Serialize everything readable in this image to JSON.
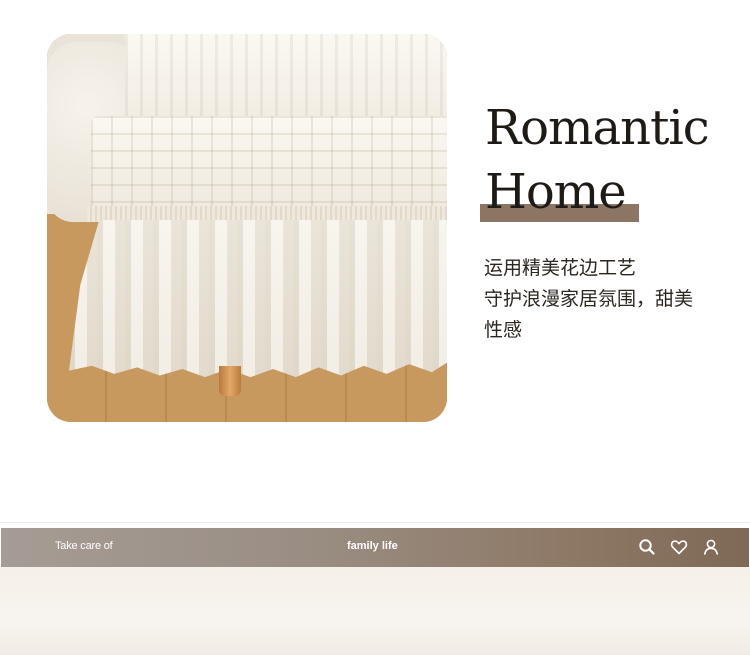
{
  "hero": {
    "title_line1": "Romantic",
    "title_line2": "Home",
    "description_lines": [
      "运用精美花边工艺",
      "守护浪漫家居氛围，甜美",
      "性感"
    ],
    "accent_color": "#8c7562"
  },
  "product_image": {
    "subject": "bed skirt photo"
  },
  "navbar": {
    "left_text": "Take care of",
    "center_text": "family life",
    "icons": [
      "search-icon",
      "heart-icon",
      "user-icon"
    ]
  }
}
